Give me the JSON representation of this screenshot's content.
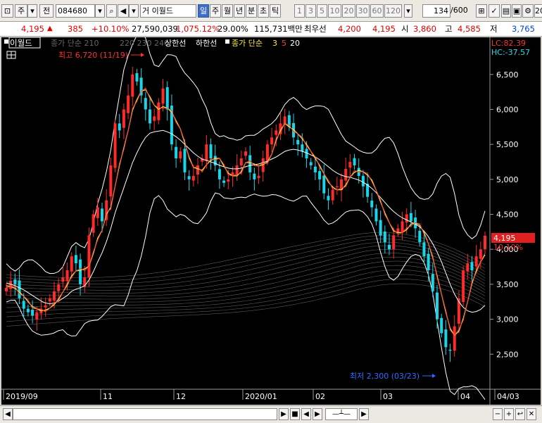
{
  "toolbar": {
    "market": "주",
    "type_label": "전",
    "code": "084680",
    "name": "거 이월드",
    "periods": [
      "일",
      "주",
      "월",
      "년",
      "분",
      "초",
      "틱"
    ],
    "active_period": "일",
    "ticks": [
      "1",
      "3",
      "5",
      "10",
      "20",
      "30",
      "60",
      "120"
    ],
    "count": "134",
    "count_total": "/600",
    "right_value": "20"
  },
  "quote": {
    "price": "4,195",
    "up_arrow": "▲",
    "change": "385",
    "change_pct": "+10.10%",
    "volume": "27,590,039",
    "volume_pct": "1,075.12%",
    "turnover": "29.00%",
    "amount": "115,731백만",
    "prio_label": "최우선",
    "prio_value": "4,200",
    "bid": "4,195",
    "open_label": "시",
    "open": "3,860",
    "high_label": "고",
    "high": "4,585",
    "low_label": "저",
    "low": "3,765"
  },
  "legend": {
    "name": "이월드",
    "ma_label": "종가 단순 210",
    "ma_extra": "220  230  240",
    "upper": "상한선",
    "lower": "하한선",
    "ma_short_label": "종가 단순",
    "ma3": "3",
    "ma5": "5",
    "ma20": "20"
  },
  "right_info": {
    "lc": "LC:82.39",
    "hc": "HC:-37.57",
    "current_price": "4,195",
    "current_pct": "10.10%"
  },
  "annotations": {
    "high": "최고 6,720 (11/19)",
    "low": "최저 2,300 (03/23)"
  },
  "colors": {
    "up": "#ff2a2a",
    "down": "#18d6e8",
    "ma3": "#ffe83a",
    "ma5": "#ff4040",
    "ma20": "#ffffff",
    "band": "#ffffff"
  },
  "chart_data": {
    "type": "candlestick",
    "y_ticks": [
      "6,500",
      "6,000",
      "5,500",
      "5,000",
      "4,500",
      "4,000",
      "3,500",
      "3,000",
      "2,500"
    ],
    "y_tick_values": [
      6500,
      6000,
      5500,
      5000,
      4500,
      4000,
      3500,
      3000,
      2500
    ],
    "x_labels": [
      "2019/09",
      "11",
      "12",
      "2020/01",
      "02",
      "03",
      "04",
      "04/03"
    ],
    "ylim": [
      2100,
      6850
    ],
    "close_series": [
      3450,
      3550,
      3500,
      3300,
      3150,
      3100,
      3050,
      3100,
      3150,
      3200,
      3300,
      3400,
      3500,
      3600,
      3700,
      3900,
      3800,
      3500,
      3600,
      4200,
      4500,
      4600,
      4400,
      4700,
      5200,
      5800,
      5700,
      6000,
      6200,
      6500,
      6400,
      6200,
      6000,
      5800,
      5900,
      6100,
      6300,
      6000,
      5500,
      5300,
      5400,
      5100,
      5000,
      5050,
      5200,
      5300,
      5500,
      5300,
      5200,
      5000,
      4950,
      5000,
      5100,
      5200,
      5300,
      5400,
      5100,
      5000,
      5050,
      5300,
      5500,
      5600,
      5700,
      5800,
      5900,
      5750,
      5600,
      5500,
      5400,
      5300,
      5200,
      5100,
      5000,
      4800,
      4700,
      4850,
      4900,
      5000,
      5150,
      5250,
      5200,
      5050,
      4900,
      4750,
      4600,
      4400,
      4200,
      4100,
      4000,
      4200,
      4300,
      4400,
      4500,
      4400,
      4300,
      4100,
      3900,
      3700,
      3400,
      3000,
      2800,
      2600,
      2550,
      2900,
      3300,
      3700,
      3800,
      3700,
      3900,
      4000,
      4195
    ],
    "ma5_series": [
      3480,
      3470,
      3440,
      3390,
      3330,
      3250,
      3180,
      3150,
      3120,
      3130,
      3160,
      3210,
      3290,
      3390,
      3490,
      3620,
      3690,
      3700,
      3720,
      3760,
      3940,
      4160,
      4270,
      4500,
      4600,
      4900,
      5200,
      5450,
      5700,
      5990,
      6140,
      6260,
      6280,
      6180,
      6060,
      6000,
      6040,
      6020,
      5960,
      5840,
      5720,
      5520,
      5320,
      5170,
      5150,
      5130,
      5210,
      5270,
      5300,
      5300,
      5190,
      5090,
      5050,
      5050,
      5110,
      5240,
      5240,
      5220,
      5190,
      5210,
      5250,
      5360,
      5560,
      5700,
      5800,
      5750,
      5710,
      5650,
      5580,
      5500,
      5400,
      5300,
      5200,
      5080,
      4960,
      4890,
      4850,
      4850,
      4920,
      5030,
      5100,
      5130,
      5110,
      5060,
      4990,
      4840,
      4680,
      4520,
      4380,
      4260,
      4240,
      4240,
      4280,
      4360,
      4380,
      4340,
      4240,
      4080,
      3880,
      3620,
      3360,
      3100,
      2870,
      2770,
      2830,
      3010,
      3250,
      3510,
      3690,
      3820,
      3920
    ],
    "ma20_series": [
      3520,
      3500,
      3480,
      3450,
      3420,
      3380,
      3340,
      3300,
      3260,
      3230,
      3220,
      3230,
      3260,
      3300,
      3340,
      3400,
      3430,
      3450,
      3480,
      3560,
      3680,
      3820,
      3950,
      4110,
      4300,
      4520,
      4700,
      4880,
      5060,
      5240,
      5380,
      5500,
      5600,
      5660,
      5680,
      5690,
      5700,
      5680,
      5650,
      5610,
      5560,
      5500,
      5440,
      5380,
      5330,
      5290,
      5270,
      5250,
      5230,
      5200,
      5180,
      5160,
      5150,
      5150,
      5160,
      5180,
      5200,
      5210,
      5220,
      5240,
      5260,
      5290,
      5320,
      5360,
      5400,
      5420,
      5430,
      5420,
      5400,
      5380,
      5350,
      5320,
      5280,
      5230,
      5180,
      5130,
      5090,
      5060,
      5040,
      5030,
      5010,
      4990,
      4960,
      4920,
      4870,
      4810,
      4740,
      4670,
      4600,
      4540,
      4490,
      4450,
      4420,
      4390,
      4360,
      4320,
      4260,
      4180,
      4080,
      3960,
      3820,
      3660,
      3500,
      3360,
      3250,
      3170,
      3120,
      3100,
      3110,
      3140,
      3200
    ]
  }
}
